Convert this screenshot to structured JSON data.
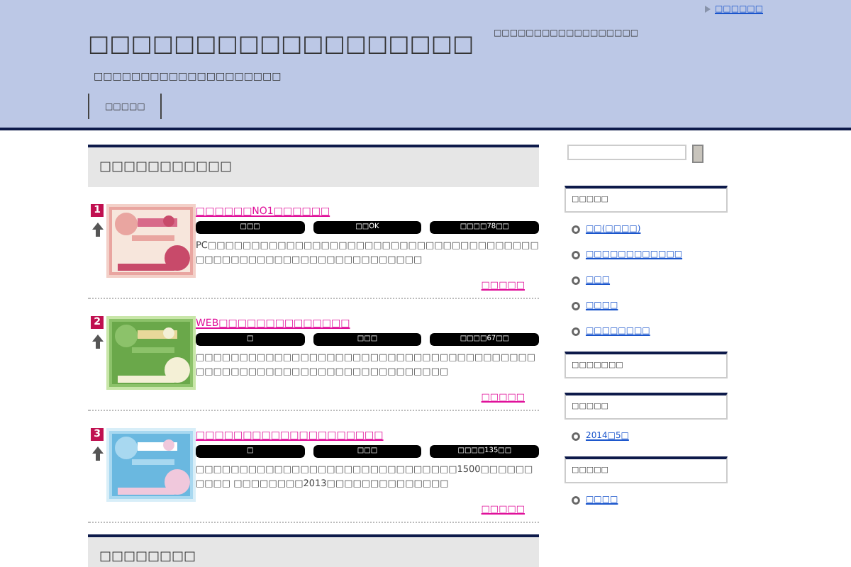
{
  "header": {
    "top_link": "□□□□□□",
    "title": "□□□□□□□□□□□□□□□□□□",
    "tagline": "□□□□□□□□□□□□□□□□□□",
    "subtitle": "□□□□□□□□□□□□□□□□□□□□",
    "nav": [
      "□□□□□"
    ]
  },
  "main": {
    "heading": "□□□□□□□□□□□",
    "items": [
      {
        "rank": "1",
        "title": "□□□□□□NO1□□□□□□",
        "tags": [
          "□□□",
          "□□OK",
          "□□□□78□□"
        ],
        "description": "PC□□□□□□□□□□□□□□□□□□□□□□□□□□□□□□□□□□□□□□□□□□□□□□□□□□□□□□□□□□□□□□□□",
        "more": "□□□□□"
      },
      {
        "rank": "2",
        "title": "WEB□□□□□□□□□□□□□□",
        "tags": [
          "□",
          "□□□",
          "□□□□67□□"
        ],
        "description": "□□□□□□□□□□□□□□□□□□□□□□□□□□□□□□□□□□□□□□□□□□□□□□□□□□□□□□□□□□□□□□□□□□□□",
        "more": "□□□□□"
      },
      {
        "rank": "3",
        "title": "□□□□□□□□□□□□□□□□□□□□",
        "tags": [
          "□",
          "□□□",
          "□□□□135□□"
        ],
        "description": "□□□□□□□□□□□□□□□□□□□□□□□□□□□□□□1500□□□□□□□□□□ □□□□□□□□2013□□□□□□□□□□□□□□",
        "more": "□□□□□"
      }
    ],
    "heading_2": "□□□□□□□□"
  },
  "sidebar": {
    "widgets": [
      {
        "title": "□□□□□",
        "links": [
          "□□(□□□□)",
          "□□□□□□□□□□□□",
          "□□□",
          "□□□□",
          "□□□□□□□□"
        ]
      },
      {
        "title": "□□□□□□□"
      },
      {
        "title": "□□□□□",
        "links": [
          "2014□5□"
        ]
      },
      {
        "title": "□□□□□",
        "links": [
          "□□□□"
        ]
      }
    ]
  }
}
